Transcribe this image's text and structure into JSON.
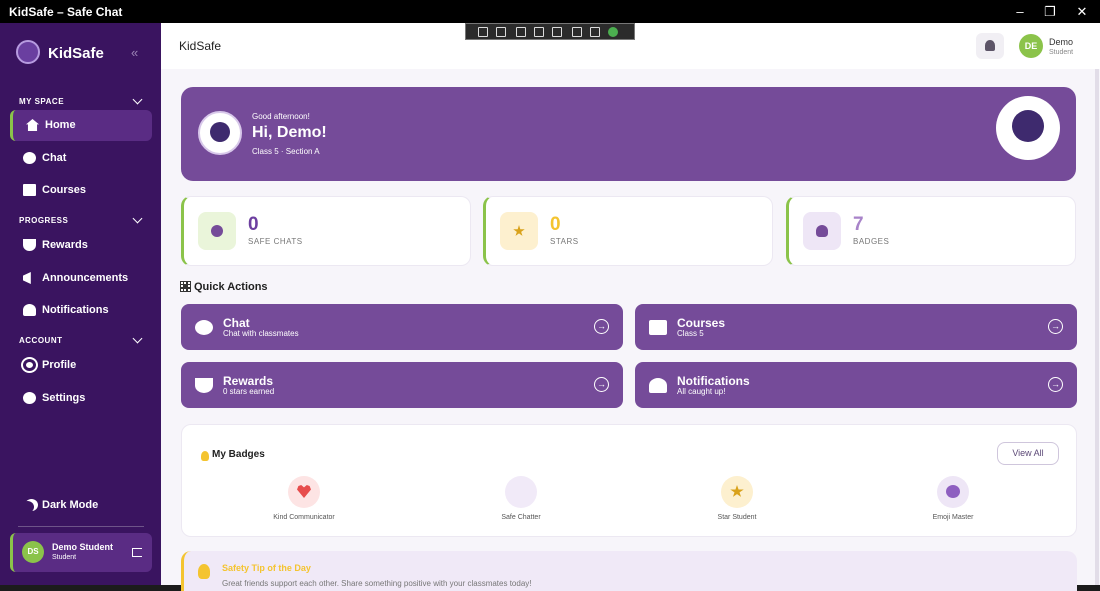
{
  "window": {
    "title": "KidSafe – Safe Chat",
    "minimize": "–",
    "maximize": "❐",
    "close": "✕"
  },
  "sidebar": {
    "app_name": "KidSafe",
    "collapse_icon": "«",
    "sections": {
      "my_space": "MY SPACE",
      "progress": "PROGRESS",
      "account": "ACCOUNT"
    },
    "items": {
      "home": "Home",
      "chat": "Chat",
      "courses": "Courses",
      "rewards": "Rewards",
      "announcements": "Announcements",
      "notifications": "Notifications",
      "profile": "Profile",
      "settings": "Settings",
      "dark_mode": "Dark Mode"
    },
    "user": {
      "initials": "DS",
      "name": "Demo Student",
      "role": "Student"
    }
  },
  "header": {
    "title": "KidSafe",
    "user_initials": "DE",
    "user_name": "Demo",
    "user_role": "Student"
  },
  "hero": {
    "greeting": "Good afternoon!",
    "headline": "Hi, Demo!",
    "class_info": "Class 5 · Section A"
  },
  "stats": [
    {
      "value": "0",
      "label": "SAFE CHATS"
    },
    {
      "value": "0",
      "label": "STARS"
    },
    {
      "value": "7",
      "label": "BADGES"
    }
  ],
  "quick_actions": {
    "title": "Quick Actions",
    "items": [
      {
        "title": "Chat",
        "subtitle": "Chat with classmates"
      },
      {
        "title": "Courses",
        "subtitle": "Class 5"
      },
      {
        "title": "Rewards",
        "subtitle": "0 stars earned"
      },
      {
        "title": "Notifications",
        "subtitle": "All caught up!"
      }
    ],
    "arrow": "→"
  },
  "badges": {
    "title": "My Badges",
    "view_all": "View All",
    "items": [
      {
        "name": "Kind Communicator",
        "icon": "heart-icon"
      },
      {
        "name": "Safe Chatter",
        "icon": "shield-icon"
      },
      {
        "name": "Star Student",
        "icon": "star-icon"
      },
      {
        "name": "Emoji Master",
        "icon": "smile-icon"
      }
    ]
  },
  "tip": {
    "title": "Safety Tip of the Day",
    "text": "Great friends support each other. Share something positive with your classmates today!"
  },
  "colors": {
    "sidebar": "#3a1460",
    "accent": "#754b99",
    "green": "#8bc34a",
    "yellow": "#f4c430"
  }
}
